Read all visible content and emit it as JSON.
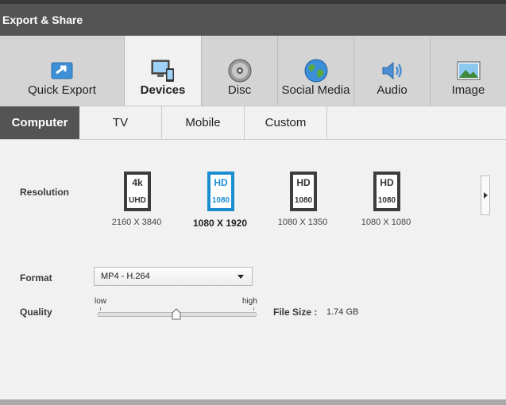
{
  "window": {
    "title": "Export & Share"
  },
  "tabs": [
    {
      "label": "Quick Export",
      "icon": "quick-export-icon"
    },
    {
      "label": "Devices",
      "icon": "devices-icon",
      "active": true
    },
    {
      "label": "Disc",
      "icon": "disc-icon"
    },
    {
      "label": "Social Media",
      "icon": "globe-icon"
    },
    {
      "label": "Audio",
      "icon": "speaker-icon"
    },
    {
      "label": "Image",
      "icon": "picture-icon"
    }
  ],
  "subtabs": [
    {
      "label": "Computer",
      "active": true
    },
    {
      "label": "TV"
    },
    {
      "label": "Mobile"
    },
    {
      "label": "Custom"
    }
  ],
  "resolution": {
    "label": "Resolution",
    "presets": [
      {
        "top": "4k",
        "bottom": "UHD",
        "caption": "2160 X 3840"
      },
      {
        "top": "HD",
        "bottom": "1080",
        "caption": "1080 X 1920",
        "selected": true
      },
      {
        "top": "HD",
        "bottom": "1080",
        "caption": "1080 X 1350"
      },
      {
        "top": "HD",
        "bottom": "1080",
        "caption": "1080 X 1080"
      }
    ]
  },
  "format": {
    "label": "Format",
    "value": "MP4 - H.264"
  },
  "quality": {
    "label": "Quality",
    "low": "low",
    "high": "high",
    "level": 0.5
  },
  "file_size": {
    "label": "File Size :",
    "value": "1.74 GB"
  },
  "colors": {
    "accent": "#1a8ed1",
    "titlebar": "#545454",
    "active_subtab": "#545454"
  }
}
